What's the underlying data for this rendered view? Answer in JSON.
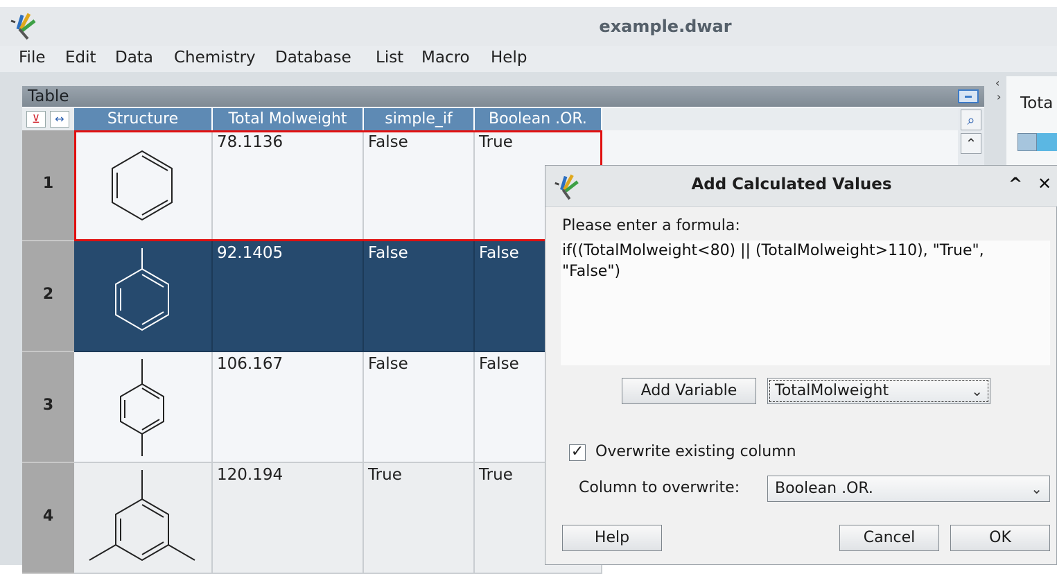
{
  "window": {
    "title": "example.dwar"
  },
  "menu": [
    {
      "label": "File"
    },
    {
      "label": "Edit"
    },
    {
      "label": "Data"
    },
    {
      "label": "Chemistry"
    },
    {
      "label": "Database"
    },
    {
      "label": "List"
    },
    {
      "label": "Macro"
    },
    {
      "label": "Help"
    }
  ],
  "table": {
    "title": "Table",
    "columns": [
      "Structure",
      "Total Molweight",
      "simple_if",
      "Boolean .OR."
    ],
    "rows": [
      {
        "num": "1",
        "mw": "78.1136",
        "simple_if": "False",
        "bool_or": "True"
      },
      {
        "num": "2",
        "mw": "92.1405",
        "simple_if": "False",
        "bool_or": "False"
      },
      {
        "num": "3",
        "mw": "106.167",
        "simple_if": "False",
        "bool_or": "False"
      },
      {
        "num": "4",
        "mw": "120.194",
        "simple_if": "True",
        "bool_or": "True"
      }
    ]
  },
  "right_panel": {
    "label": "Tota"
  },
  "dialog": {
    "title": "Add Calculated Values",
    "formula_label": "Please enter a formula:",
    "formula": "if((TotalMolweight<80) || (TotalMolweight>110), \"True\",\n\"False\")",
    "add_variable": "Add Variable",
    "variable_selected": "TotalMolweight",
    "overwrite_label": "Overwrite existing column",
    "overwrite_checked": true,
    "column_label": "Column to overwrite:",
    "column_selected": "Boolean .OR.",
    "help": "Help",
    "cancel": "Cancel",
    "ok": "OK"
  },
  "colors": {
    "selected_row": "#264a6e",
    "header": "#5e8ab4",
    "current_outline": "#e01010"
  }
}
